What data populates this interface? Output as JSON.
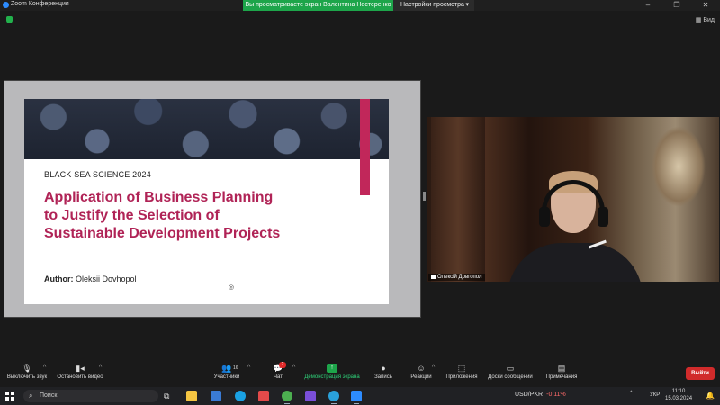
{
  "window": {
    "title": "Zoom Конференция",
    "share_banner": "Вы просматриваете экран Валентина Нестеренко",
    "view_options": "Настройки просмотра",
    "view_button": "Вид"
  },
  "slide": {
    "conference": "BLACK SEA SCIENCE  2024",
    "title_line1": "Application of Business Planning",
    "title_line2": "to Justify the Selection of",
    "title_line3": "Sustainable Development Projects",
    "author_label": "Author:",
    "author_name": "Oleksii Dovhopol",
    "accent_color": "#c1275a"
  },
  "participant": {
    "name": "Олексій Довгопол"
  },
  "toolbar": {
    "mute": "Выключить звук",
    "stop_video": "Остановить видео",
    "participants": "Участники",
    "participants_count": "16",
    "chat": "Чат",
    "chat_badge": "2",
    "share_screen": "Демонстрация экрана",
    "record": "Запись",
    "reactions": "Реакции",
    "apps": "Приложения",
    "whiteboards": "Доски сообщений",
    "notes": "Примечания",
    "leave": "Выйти"
  },
  "taskbar": {
    "search_placeholder": "Поиск",
    "ticker_symbol": "USD/PKR",
    "ticker_change": "-0.11%",
    "language": "УКР",
    "time": "11:10",
    "date": "15.03.2024"
  }
}
